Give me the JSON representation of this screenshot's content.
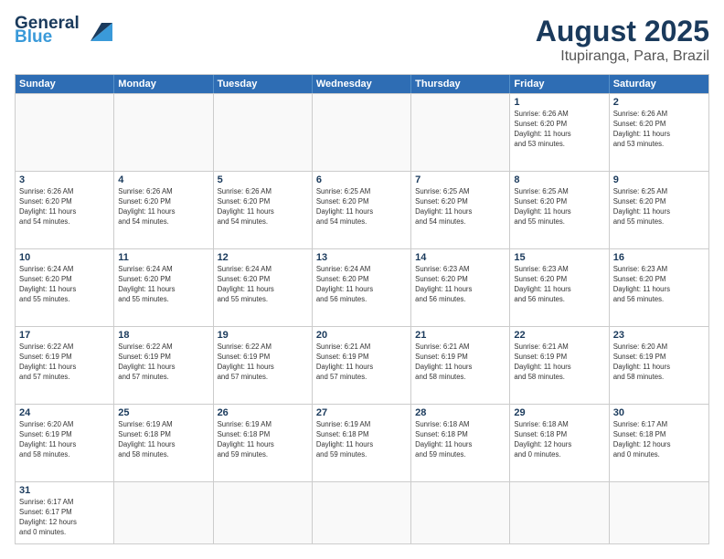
{
  "header": {
    "logo_general": "General",
    "logo_blue": "Blue",
    "title": "August 2025",
    "subtitle": "Itupiranga, Para, Brazil"
  },
  "days_of_week": [
    "Sunday",
    "Monday",
    "Tuesday",
    "Wednesday",
    "Thursday",
    "Friday",
    "Saturday"
  ],
  "rows": [
    [
      {
        "day": "",
        "info": ""
      },
      {
        "day": "",
        "info": ""
      },
      {
        "day": "",
        "info": ""
      },
      {
        "day": "",
        "info": ""
      },
      {
        "day": "",
        "info": ""
      },
      {
        "day": "1",
        "info": "Sunrise: 6:26 AM\nSunset: 6:20 PM\nDaylight: 11 hours\nand 53 minutes."
      },
      {
        "day": "2",
        "info": "Sunrise: 6:26 AM\nSunset: 6:20 PM\nDaylight: 11 hours\nand 53 minutes."
      }
    ],
    [
      {
        "day": "3",
        "info": "Sunrise: 6:26 AM\nSunset: 6:20 PM\nDaylight: 11 hours\nand 54 minutes."
      },
      {
        "day": "4",
        "info": "Sunrise: 6:26 AM\nSunset: 6:20 PM\nDaylight: 11 hours\nand 54 minutes."
      },
      {
        "day": "5",
        "info": "Sunrise: 6:26 AM\nSunset: 6:20 PM\nDaylight: 11 hours\nand 54 minutes."
      },
      {
        "day": "6",
        "info": "Sunrise: 6:25 AM\nSunset: 6:20 PM\nDaylight: 11 hours\nand 54 minutes."
      },
      {
        "day": "7",
        "info": "Sunrise: 6:25 AM\nSunset: 6:20 PM\nDaylight: 11 hours\nand 54 minutes."
      },
      {
        "day": "8",
        "info": "Sunrise: 6:25 AM\nSunset: 6:20 PM\nDaylight: 11 hours\nand 55 minutes."
      },
      {
        "day": "9",
        "info": "Sunrise: 6:25 AM\nSunset: 6:20 PM\nDaylight: 11 hours\nand 55 minutes."
      }
    ],
    [
      {
        "day": "10",
        "info": "Sunrise: 6:24 AM\nSunset: 6:20 PM\nDaylight: 11 hours\nand 55 minutes."
      },
      {
        "day": "11",
        "info": "Sunrise: 6:24 AM\nSunset: 6:20 PM\nDaylight: 11 hours\nand 55 minutes."
      },
      {
        "day": "12",
        "info": "Sunrise: 6:24 AM\nSunset: 6:20 PM\nDaylight: 11 hours\nand 55 minutes."
      },
      {
        "day": "13",
        "info": "Sunrise: 6:24 AM\nSunset: 6:20 PM\nDaylight: 11 hours\nand 56 minutes."
      },
      {
        "day": "14",
        "info": "Sunrise: 6:23 AM\nSunset: 6:20 PM\nDaylight: 11 hours\nand 56 minutes."
      },
      {
        "day": "15",
        "info": "Sunrise: 6:23 AM\nSunset: 6:20 PM\nDaylight: 11 hours\nand 56 minutes."
      },
      {
        "day": "16",
        "info": "Sunrise: 6:23 AM\nSunset: 6:20 PM\nDaylight: 11 hours\nand 56 minutes."
      }
    ],
    [
      {
        "day": "17",
        "info": "Sunrise: 6:22 AM\nSunset: 6:19 PM\nDaylight: 11 hours\nand 57 minutes."
      },
      {
        "day": "18",
        "info": "Sunrise: 6:22 AM\nSunset: 6:19 PM\nDaylight: 11 hours\nand 57 minutes."
      },
      {
        "day": "19",
        "info": "Sunrise: 6:22 AM\nSunset: 6:19 PM\nDaylight: 11 hours\nand 57 minutes."
      },
      {
        "day": "20",
        "info": "Sunrise: 6:21 AM\nSunset: 6:19 PM\nDaylight: 11 hours\nand 57 minutes."
      },
      {
        "day": "21",
        "info": "Sunrise: 6:21 AM\nSunset: 6:19 PM\nDaylight: 11 hours\nand 58 minutes."
      },
      {
        "day": "22",
        "info": "Sunrise: 6:21 AM\nSunset: 6:19 PM\nDaylight: 11 hours\nand 58 minutes."
      },
      {
        "day": "23",
        "info": "Sunrise: 6:20 AM\nSunset: 6:19 PM\nDaylight: 11 hours\nand 58 minutes."
      }
    ],
    [
      {
        "day": "24",
        "info": "Sunrise: 6:20 AM\nSunset: 6:19 PM\nDaylight: 11 hours\nand 58 minutes."
      },
      {
        "day": "25",
        "info": "Sunrise: 6:19 AM\nSunset: 6:18 PM\nDaylight: 11 hours\nand 58 minutes."
      },
      {
        "day": "26",
        "info": "Sunrise: 6:19 AM\nSunset: 6:18 PM\nDaylight: 11 hours\nand 59 minutes."
      },
      {
        "day": "27",
        "info": "Sunrise: 6:19 AM\nSunset: 6:18 PM\nDaylight: 11 hours\nand 59 minutes."
      },
      {
        "day": "28",
        "info": "Sunrise: 6:18 AM\nSunset: 6:18 PM\nDaylight: 11 hours\nand 59 minutes."
      },
      {
        "day": "29",
        "info": "Sunrise: 6:18 AM\nSunset: 6:18 PM\nDaylight: 12 hours\nand 0 minutes."
      },
      {
        "day": "30",
        "info": "Sunrise: 6:17 AM\nSunset: 6:18 PM\nDaylight: 12 hours\nand 0 minutes."
      }
    ],
    [
      {
        "day": "31",
        "info": "Sunrise: 6:17 AM\nSunset: 6:17 PM\nDaylight: 12 hours\nand 0 minutes."
      },
      {
        "day": "",
        "info": ""
      },
      {
        "day": "",
        "info": ""
      },
      {
        "day": "",
        "info": ""
      },
      {
        "day": "",
        "info": ""
      },
      {
        "day": "",
        "info": ""
      },
      {
        "day": "",
        "info": ""
      }
    ]
  ]
}
